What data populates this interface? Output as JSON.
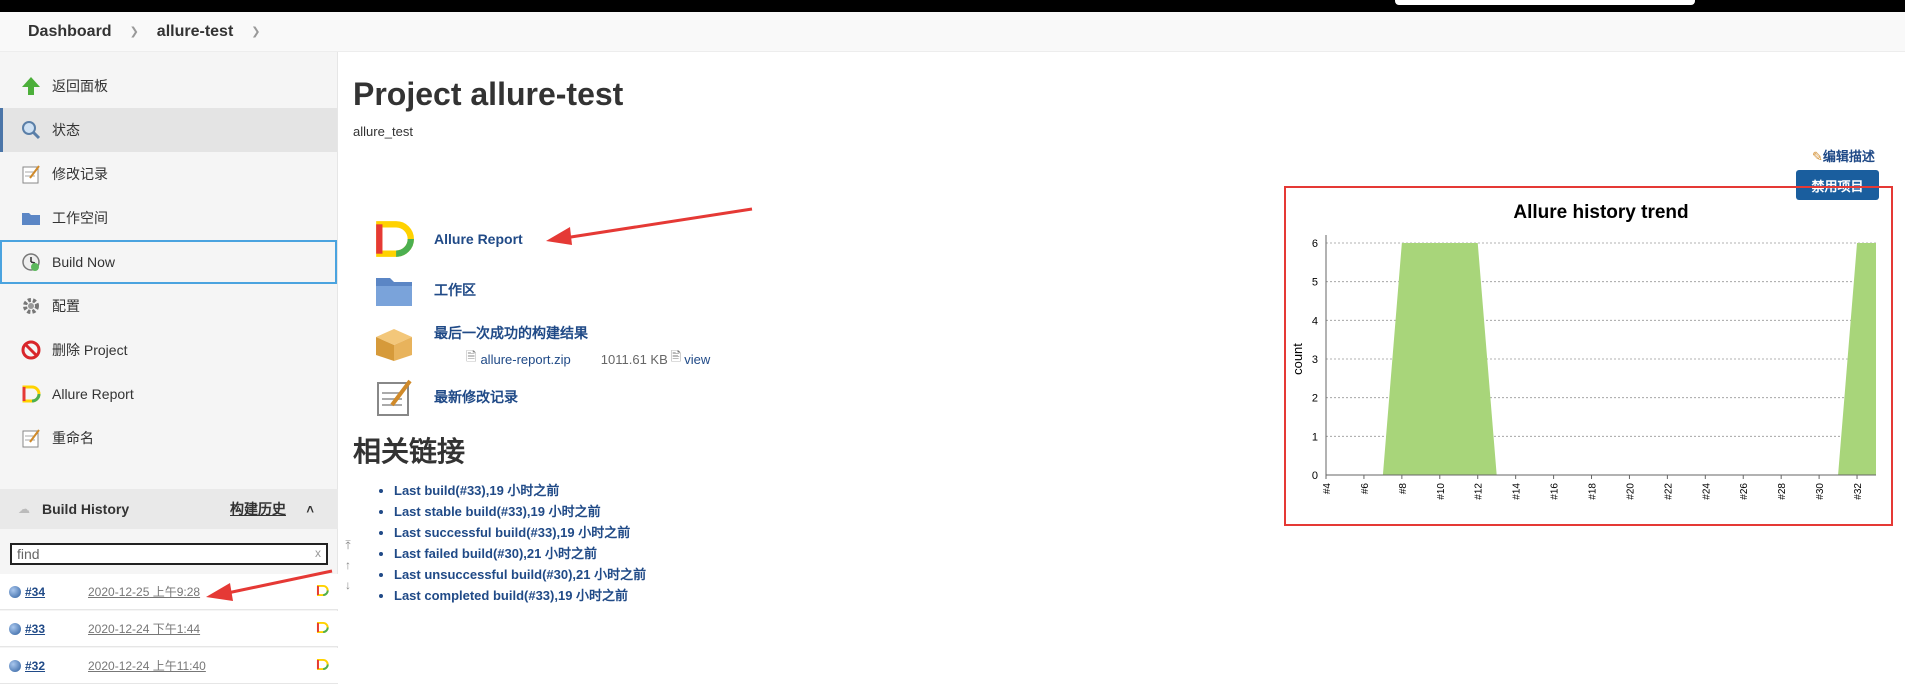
{
  "breadcrumb": {
    "items": [
      "Dashboard",
      "allure-test"
    ]
  },
  "sidebar": {
    "tasks": [
      {
        "label": "返回面板",
        "icon": "up-arrow-icon"
      },
      {
        "label": "状态",
        "icon": "search-icon"
      },
      {
        "label": "修改记录",
        "icon": "notepad-icon"
      },
      {
        "label": "工作空间",
        "icon": "folder-icon"
      },
      {
        "label": "Build Now",
        "icon": "clock-icon"
      },
      {
        "label": "配置",
        "icon": "gear-icon"
      },
      {
        "label": "删除 Project",
        "icon": "no-entry-icon"
      },
      {
        "label": "Allure Report",
        "icon": "allure-icon"
      },
      {
        "label": "重命名",
        "icon": "notepad-icon"
      }
    ],
    "build_history": {
      "title": "Build History",
      "trend_label": "构建历史",
      "filter_placeholder": "find",
      "filter_clear": "x",
      "builds": [
        {
          "number": "#34",
          "date": "2020-12-25 上午9:28"
        },
        {
          "number": "#33",
          "date": "2020-12-24 下午1:44"
        },
        {
          "number": "#32",
          "date": "2020-12-24 上午11:40"
        }
      ]
    }
  },
  "main": {
    "title": "Project allure-test",
    "description": "allure_test",
    "edit_description": "编辑描述",
    "disable_button": "禁用项目",
    "links": {
      "allure_report": "Allure Report",
      "workspace": "工作区",
      "last_success_artifacts": "最后一次成功的构建结果",
      "artifact_name": "allure-report.zip",
      "artifact_size": "1011.61 KB",
      "artifact_view": "view",
      "recent_changes": "最新修改记录"
    },
    "related_title": "相关链接",
    "related_links": [
      "Last build(#33),19 小时之前",
      "Last stable build(#33),19 小时之前",
      "Last successful build(#33),19 小时之前",
      "Last failed build(#30),21 小时之前",
      "Last unsuccessful build(#30),21 小时之前",
      "Last completed build(#33),19 小时之前"
    ]
  },
  "colors": {
    "accent": "#1a5e9e",
    "link": "#204a87",
    "chart_fill": "#a8d57a",
    "highlight": "#e53935"
  },
  "chart_data": {
    "type": "area",
    "title": "Allure history trend",
    "ylabel": "count",
    "xlabel": "",
    "ylim": [
      0,
      6
    ],
    "y_ticks": [
      0,
      1,
      2,
      3,
      4,
      5,
      6
    ],
    "x_tick_labels": [
      "#4",
      "#6",
      "#8",
      "#10",
      "#12",
      "#14",
      "#16",
      "#18",
      "#20",
      "#22",
      "#24",
      "#26",
      "#28",
      "#30",
      "#32"
    ],
    "x": [
      4,
      5,
      6,
      7,
      8,
      9,
      10,
      11,
      12,
      13,
      14,
      15,
      16,
      17,
      18,
      19,
      20,
      21,
      22,
      23,
      24,
      25,
      26,
      27,
      28,
      29,
      30,
      31,
      32,
      33
    ],
    "values": [
      0,
      0,
      0,
      0,
      6,
      6,
      6,
      6,
      6,
      0,
      0,
      0,
      0,
      0,
      0,
      0,
      0,
      0,
      0,
      0,
      0,
      0,
      0,
      0,
      0,
      0,
      0,
      0,
      6,
      6
    ],
    "grid": true
  }
}
